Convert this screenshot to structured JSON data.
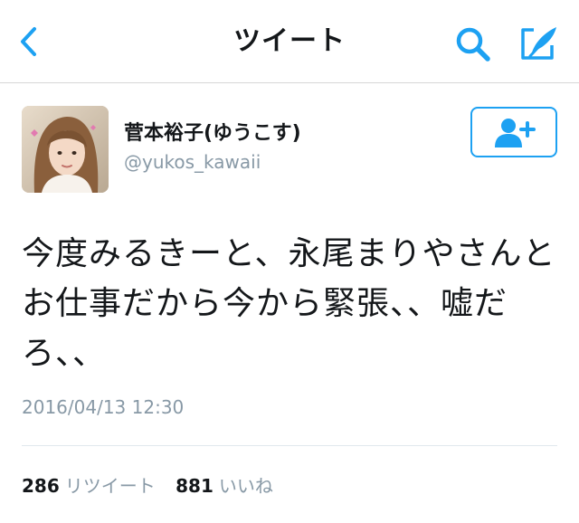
{
  "nav": {
    "title": "ツイート",
    "back_icon": "chevron-left-icon",
    "search_icon": "search-icon",
    "compose_icon": "compose-tweet-icon"
  },
  "tweet": {
    "author": {
      "display_name": "菅本裕子(ゆうこす)",
      "handle": "@yukos_kawaii",
      "avatar_icon": "avatar"
    },
    "follow_icon": "add-user-icon",
    "text": "今度みるきーと、永尾まりやさんとお仕事だから今から緊張、、嘘だろ、、",
    "timestamp": "2016/04/13 12:30",
    "stats": {
      "retweets_count": "286",
      "retweets_label": "リツイート",
      "likes_count": "881",
      "likes_label": "いいね"
    }
  },
  "colors": {
    "accent": "#1da1f2",
    "secondary_text": "#8899a6",
    "divider": "#e1e8ed"
  }
}
